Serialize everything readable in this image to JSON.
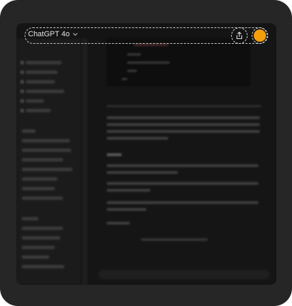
{
  "header": {
    "model_label": "ChatGPT 4o",
    "chevron_icon": "chevron-down-icon",
    "share_icon": "share-icon",
    "avatar_icon": "avatar"
  },
  "colors": {
    "frame": "#262626",
    "window": "#141414",
    "accent_avatar": "#f59e0b",
    "outline": "#d9d9d9"
  }
}
